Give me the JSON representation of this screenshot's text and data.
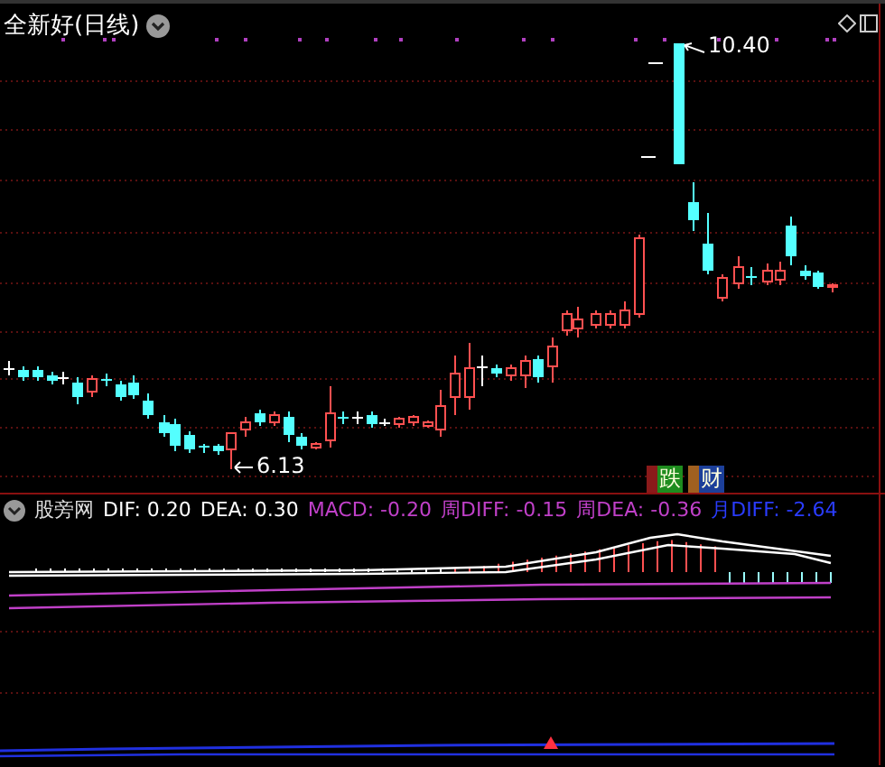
{
  "chart": {
    "title": "全新好(日线)",
    "high_label": "10.40",
    "low_label": "6.13",
    "signals": [
      {
        "label": "跌",
        "color": "#1e8c1e"
      },
      {
        "label": "财",
        "color": "#1c3f9a"
      }
    ]
  },
  "indicator": {
    "name": "股旁网",
    "values": [
      {
        "text": "DIF: 0.20",
        "color": "#ffffff"
      },
      {
        "text": "DEA: 0.30",
        "color": "#ffffff"
      },
      {
        "text": "MACD: -0.20",
        "color": "#c040c8"
      },
      {
        "text": "周DIFF: -0.15",
        "color": "#c040c8"
      },
      {
        "text": "周DEA: -0.36",
        "color": "#c040c8"
      },
      {
        "text": "月DIFF: -2.64",
        "color": "#2a3cff"
      }
    ]
  }
}
